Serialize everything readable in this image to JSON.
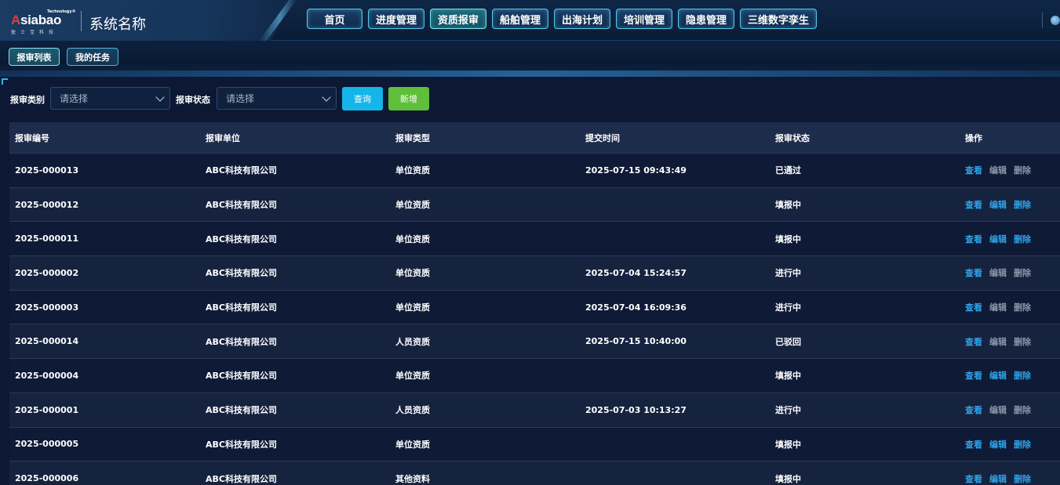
{
  "brand": {
    "logo_sup": "Technology®",
    "logo_a": "A",
    "logo_rest": "siabao",
    "logo_sub": "盈士宝科技",
    "title": "系统名称"
  },
  "nav": {
    "items": [
      {
        "label": "首页",
        "active": false
      },
      {
        "label": "进度管理",
        "active": false
      },
      {
        "label": "资质报审",
        "active": true
      },
      {
        "label": "船舶管理",
        "active": false
      },
      {
        "label": "出海计划",
        "active": false
      },
      {
        "label": "培训管理",
        "active": false
      },
      {
        "label": "隐患管理",
        "active": false
      },
      {
        "label": "三维数字孪生",
        "active": false
      }
    ]
  },
  "subtabs": [
    {
      "label": "报审列表",
      "active": true
    },
    {
      "label": "我的任务",
      "active": false
    }
  ],
  "filters": {
    "category_label": "报审类别",
    "category_placeholder": "请选择",
    "status_label": "报审状态",
    "status_placeholder": "请选择",
    "query_label": "查询",
    "add_label": "新增"
  },
  "colors": {
    "accent": "#14b6ea",
    "add": "#5fbf3a",
    "link": "#2fa3e8",
    "link_dim": "#8a96a8"
  },
  "table": {
    "headers": [
      "报审编号",
      "报审单位",
      "报审类型",
      "提交时间",
      "报审状态",
      "操作"
    ],
    "op_labels": {
      "view": "查看",
      "edit": "编辑",
      "delete": "删除"
    },
    "rows": [
      {
        "id": "2025-000013",
        "unit": "ABC科技有限公司",
        "type": "单位资质",
        "time": "2025-07-15 09:43:49",
        "status": "已通过",
        "editable": false
      },
      {
        "id": "2025-000012",
        "unit": "ABC科技有限公司",
        "type": "单位资质",
        "time": "",
        "status": "填报中",
        "editable": true
      },
      {
        "id": "2025-000011",
        "unit": "ABC科技有限公司",
        "type": "单位资质",
        "time": "",
        "status": "填报中",
        "editable": true
      },
      {
        "id": "2025-000002",
        "unit": "ABC科技有限公司",
        "type": "单位资质",
        "time": "2025-07-04 15:24:57",
        "status": "进行中",
        "editable": false
      },
      {
        "id": "2025-000003",
        "unit": "ABC科技有限公司",
        "type": "单位资质",
        "time": "2025-07-04 16:09:36",
        "status": "进行中",
        "editable": false
      },
      {
        "id": "2025-000014",
        "unit": "ABC科技有限公司",
        "type": "人员资质",
        "time": "2025-07-15 10:40:00",
        "status": "已驳回",
        "editable": false
      },
      {
        "id": "2025-000004",
        "unit": "ABC科技有限公司",
        "type": "单位资质",
        "time": "",
        "status": "填报中",
        "editable": true
      },
      {
        "id": "2025-000001",
        "unit": "ABC科技有限公司",
        "type": "人员资质",
        "time": "2025-07-03 10:13:27",
        "status": "进行中",
        "editable": false
      },
      {
        "id": "2025-000005",
        "unit": "ABC科技有限公司",
        "type": "单位资质",
        "time": "",
        "status": "填报中",
        "editable": true
      },
      {
        "id": "2025-000006",
        "unit": "ABC科技有限公司",
        "type": "其他资料",
        "time": "",
        "status": "填报中",
        "editable": true
      }
    ]
  }
}
